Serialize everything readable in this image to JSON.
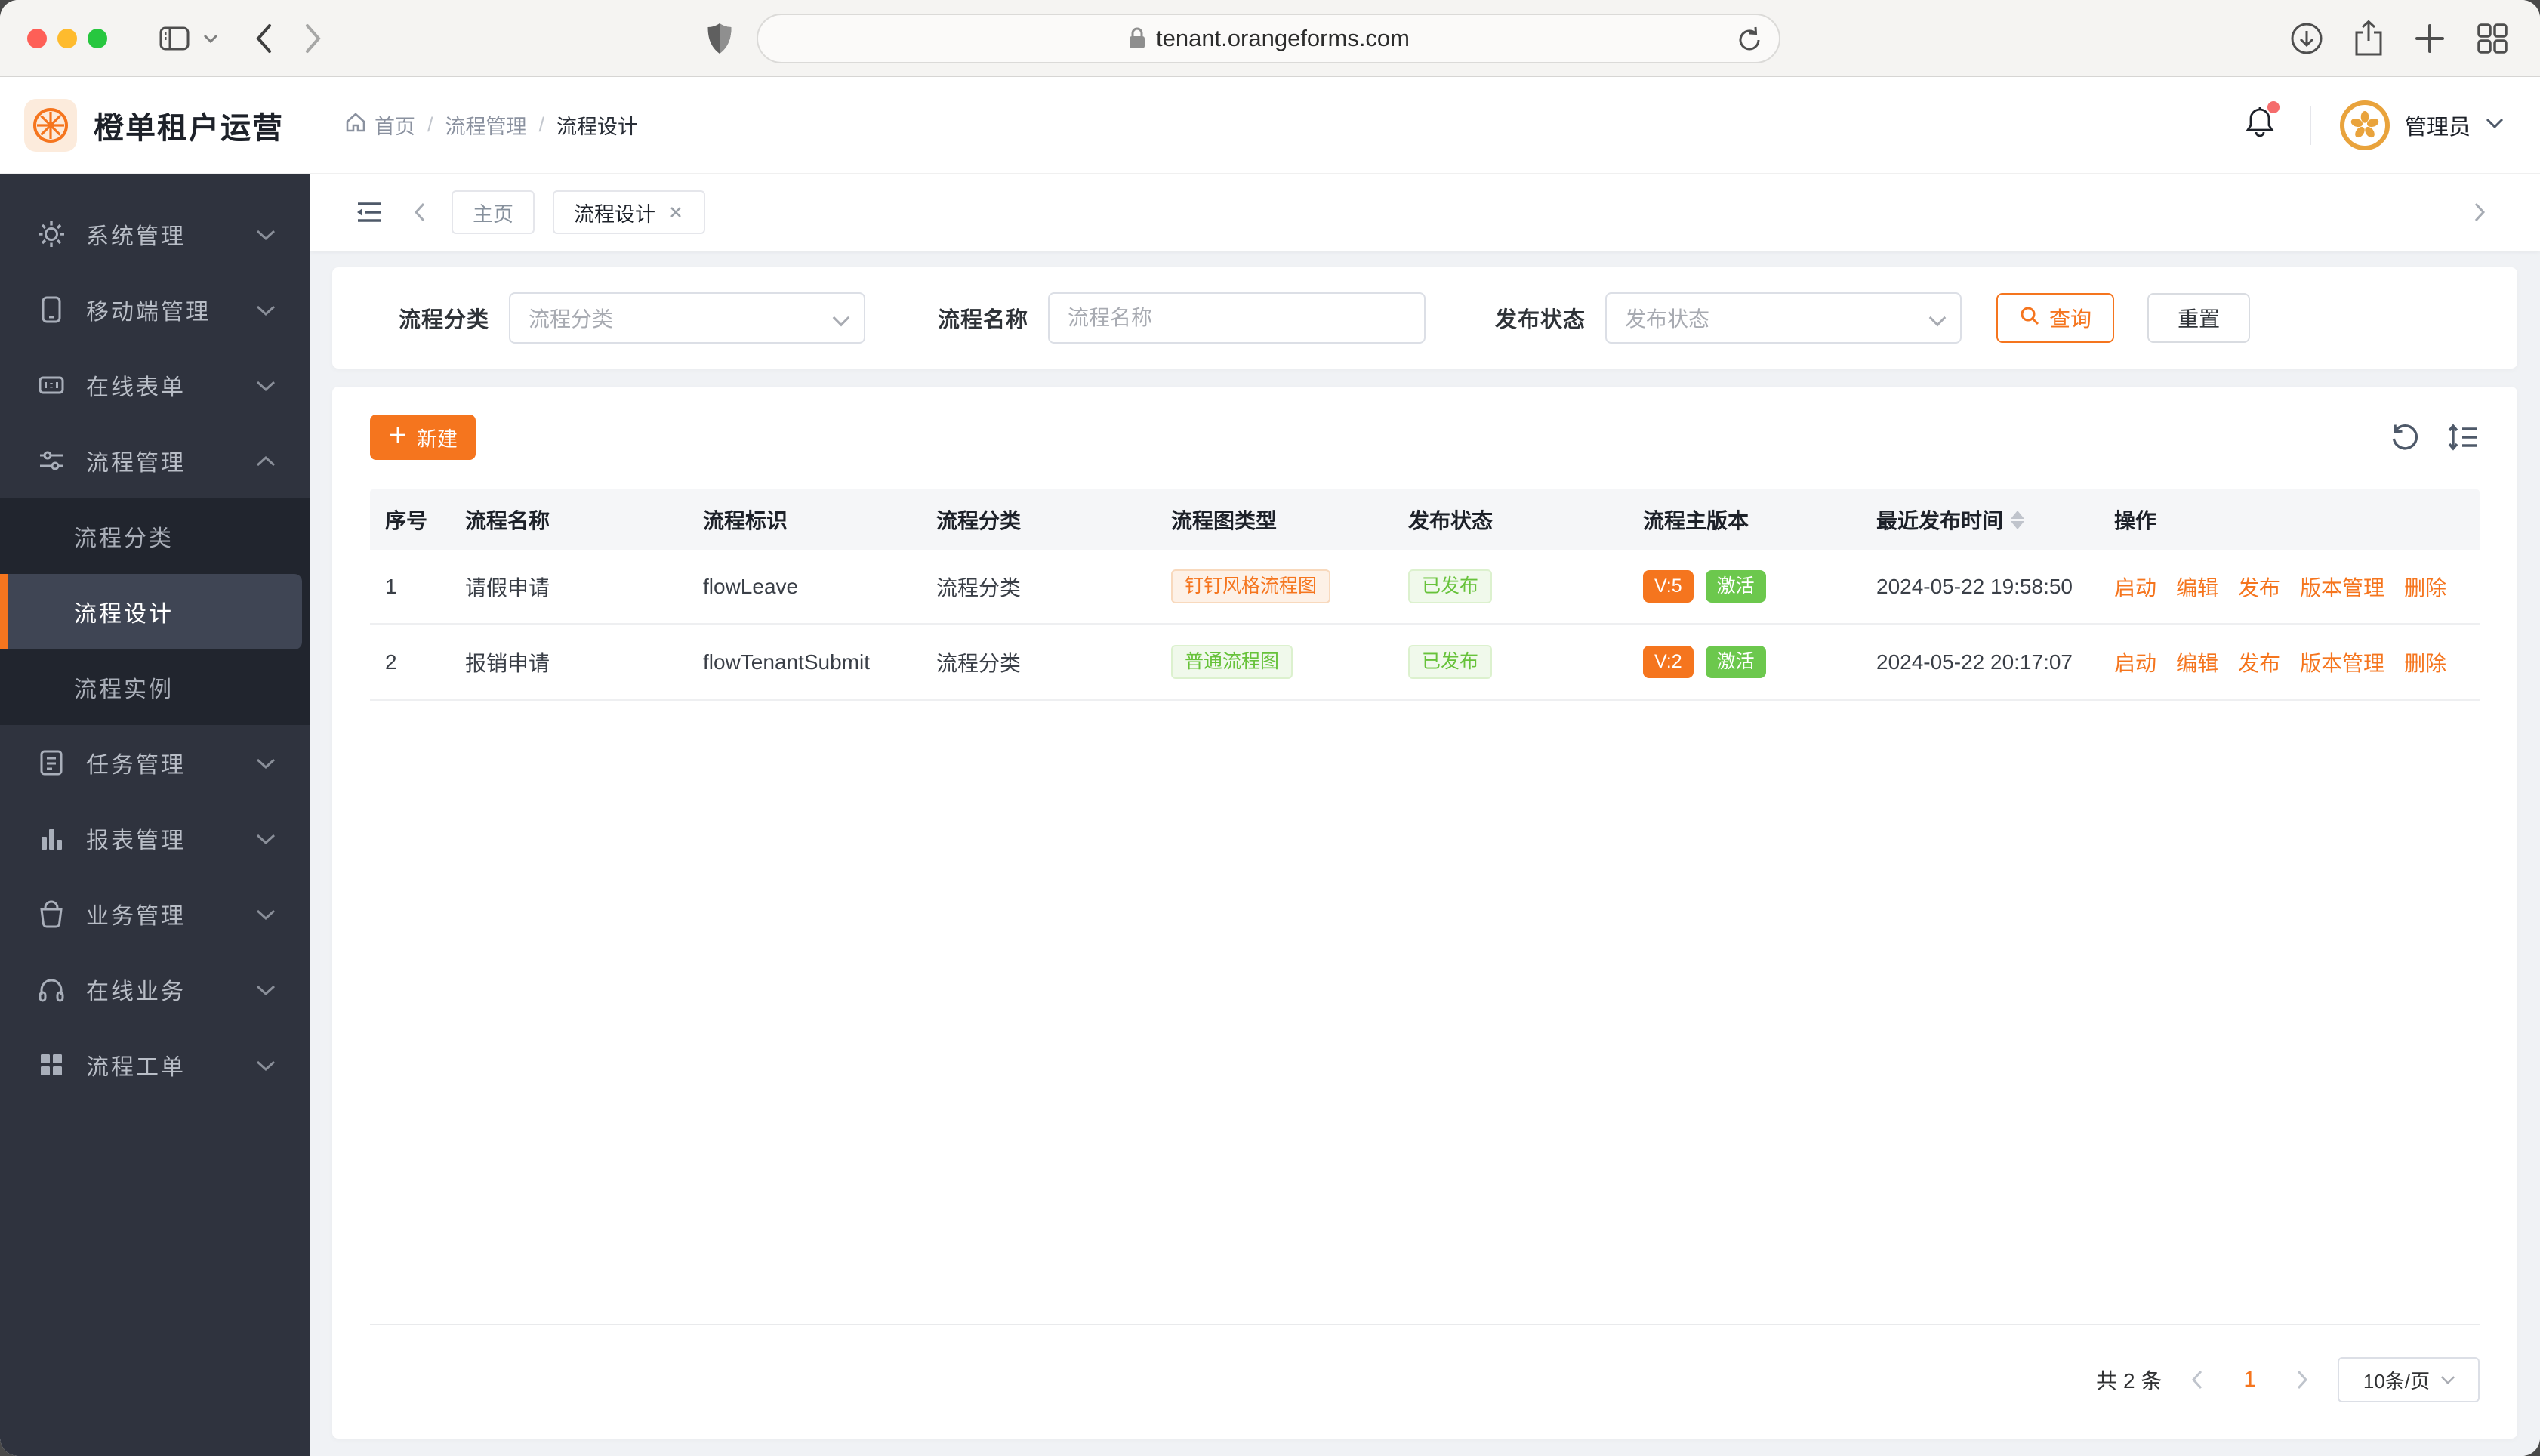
{
  "browser": {
    "url": "tenant.orangeforms.com"
  },
  "header": {
    "app_title": "橙单租户运营",
    "breadcrumb": {
      "home": "首页",
      "level2": "流程管理",
      "level3": "流程设计"
    },
    "user_name": "管理员"
  },
  "sidebar": {
    "items": [
      {
        "label": "系统管理",
        "icon": "gear-icon"
      },
      {
        "label": "移动端管理",
        "icon": "mobile-icon"
      },
      {
        "label": "在线表单",
        "icon": "form-icon"
      },
      {
        "label": "流程管理",
        "icon": "sliders-icon"
      },
      {
        "label": "任务管理",
        "icon": "task-icon"
      },
      {
        "label": "报表管理",
        "icon": "bar-chart-icon"
      },
      {
        "label": "业务管理",
        "icon": "bag-icon"
      },
      {
        "label": "在线业务",
        "icon": "headset-icon"
      },
      {
        "label": "流程工单",
        "icon": "grid-icon"
      }
    ],
    "submenu": {
      "item1": "流程分类",
      "item2": "流程设计",
      "item3": "流程实例"
    }
  },
  "tabs": {
    "tab1": "主页",
    "tab2": "流程设计"
  },
  "filters": {
    "category_label": "流程分类",
    "category_placeholder": "流程分类",
    "name_label": "流程名称",
    "name_placeholder": "流程名称",
    "status_label": "发布状态",
    "status_placeholder": "发布状态",
    "search_label": "查询",
    "reset_label": "重置"
  },
  "toolbar": {
    "create_label": "新建"
  },
  "table": {
    "headers": [
      "序号",
      "流程名称",
      "流程标识",
      "流程分类",
      "流程图类型",
      "发布状态",
      "流程主版本",
      "最近发布时间",
      "操作"
    ],
    "action_labels": [
      "启动",
      "编辑",
      "发布",
      "版本管理",
      "删除"
    ],
    "rows": [
      {
        "index": "1",
        "name": "请假申请",
        "key": "flowLeave",
        "category": "流程分类",
        "diagram_type": "钉钉风格流程图",
        "diagram_variant": "orange",
        "publish_status": "已发布",
        "version": "V:5",
        "active_status": "激活",
        "published_at": "2024-05-22 19:58:50"
      },
      {
        "index": "2",
        "name": "报销申请",
        "key": "flowTenantSubmit",
        "category": "流程分类",
        "diagram_type": "普通流程图",
        "diagram_variant": "green",
        "publish_status": "已发布",
        "version": "V:2",
        "active_status": "激活",
        "published_at": "2024-05-22 20:17:07"
      }
    ]
  },
  "pagination": {
    "total": "共 2 条",
    "current_page": "1",
    "page_size": "10条/页"
  },
  "colors": {
    "accent_orange": "#f5751e",
    "success_green": "#6cc84d",
    "green_text": "#67c23a",
    "sidebar_bg": "#2f333e",
    "submenu_bg": "#21252e",
    "active_item_bg": "#3f4554",
    "content_bg": "#f0f2f5",
    "danger_badge": "#f56c6c"
  }
}
